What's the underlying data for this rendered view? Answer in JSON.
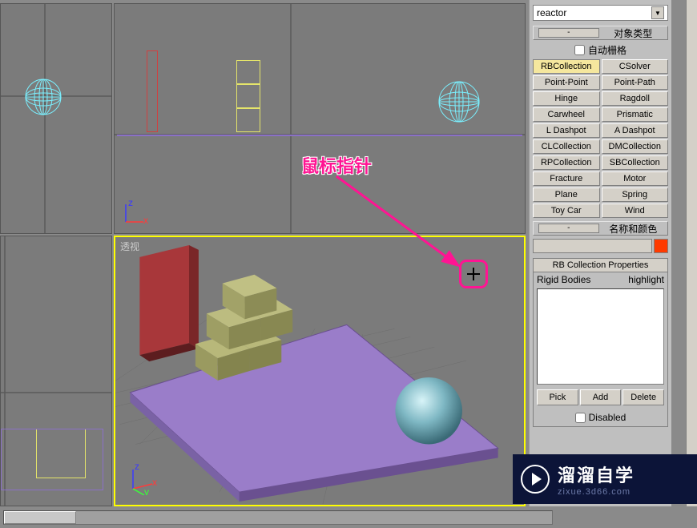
{
  "dropdown": {
    "selected": "reactor"
  },
  "rollout1": {
    "title": "对象类型",
    "autogrid_label": "自动栅格"
  },
  "object_buttons": [
    [
      "RBCollection",
      "CSolver"
    ],
    [
      "Point-Point",
      "Point-Path"
    ],
    [
      "Hinge",
      "Ragdoll"
    ],
    [
      "Carwheel",
      "Prismatic"
    ],
    [
      "L Dashpot",
      "A Dashpot"
    ],
    [
      "CLCollection",
      "DMCollection"
    ],
    [
      "RPCollection",
      "SBCollection"
    ],
    [
      "Fracture",
      "Motor"
    ],
    [
      "Plane",
      "Spring"
    ],
    [
      "Toy Car",
      "Wind"
    ]
  ],
  "selected_button": "RBCollection",
  "rollout2": {
    "title": "名称和颜色"
  },
  "rb_props": {
    "header": "RB Collection Properties",
    "col1": "Rigid Bodies",
    "col2": "highlight",
    "pick": "Pick",
    "add": "Add",
    "delete": "Delete",
    "disabled": "Disabled"
  },
  "viewports": {
    "perspective_label": "透视"
  },
  "annotation": {
    "label": "鼠标指针"
  },
  "watermark": {
    "brand": "溜溜自学",
    "url": "zixue.3d66.com"
  }
}
